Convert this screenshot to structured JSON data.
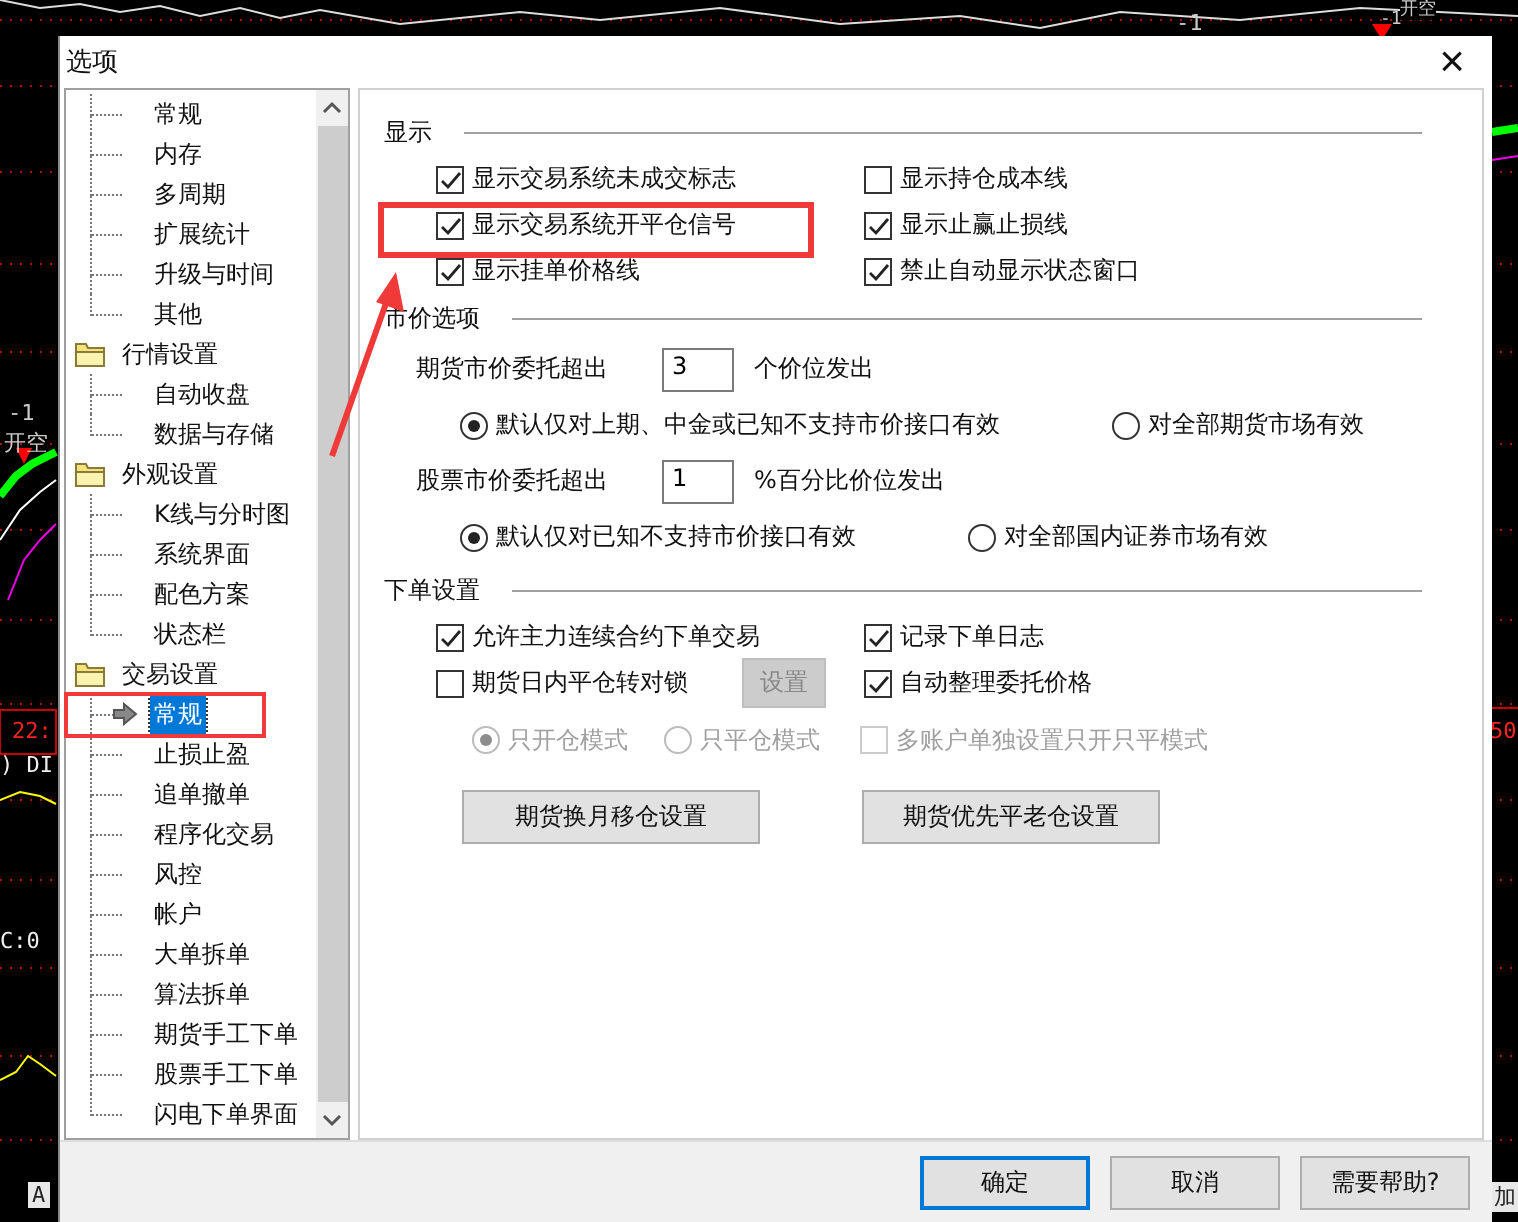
{
  "background": {
    "labels": [
      "-1",
      "开空",
      "-1",
      "-1",
      "开空",
      "22:",
      ") DI",
      "C:0",
      "A",
      "50",
      "加"
    ]
  },
  "window": {
    "title": "选项",
    "close": "×"
  },
  "tree": [
    {
      "children": [
        {
          "label": "常规",
          "selected": false
        },
        {
          "label": "内存",
          "selected": false
        },
        {
          "label": "多周期",
          "selected": false
        },
        {
          "label": "扩展统计",
          "selected": false
        },
        {
          "label": "升级与时间",
          "selected": false
        },
        {
          "label": "其他",
          "selected": false
        }
      ]
    },
    {
      "label": "行情设置",
      "children": [
        {
          "label": "自动收盘",
          "selected": false
        },
        {
          "label": "数据与存储",
          "selected": false
        }
      ]
    },
    {
      "label": "外观设置",
      "children": [
        {
          "label": "K线与分时图",
          "selected": false
        },
        {
          "label": "系统界面",
          "selected": false
        },
        {
          "label": "配色方案",
          "selected": false
        },
        {
          "label": "状态栏",
          "selected": false
        }
      ]
    },
    {
      "label": "交易设置",
      "children": [
        {
          "label": "常规",
          "selected": true
        },
        {
          "label": "止损止盈",
          "selected": false
        },
        {
          "label": "追单撤单",
          "selected": false
        },
        {
          "label": "程序化交易",
          "selected": false
        },
        {
          "label": "风控",
          "selected": false
        },
        {
          "label": "帐户",
          "selected": false
        },
        {
          "label": "大单拆单",
          "selected": false
        },
        {
          "label": "算法拆单",
          "selected": false
        },
        {
          "label": "期货手工下单",
          "selected": false
        },
        {
          "label": "股票手工下单",
          "selected": false
        },
        {
          "label": "闪电下单界面",
          "selected": false
        }
      ]
    }
  ],
  "sections": [
    {
      "title": "显示",
      "rows": [
        {
          "kind": "pair",
          "left": [
            {
              "kind": "checkbox",
              "label": "显示交易系统未成交标志",
              "checked": true,
              "disabled": false
            }
          ],
          "right": [
            {
              "kind": "checkbox",
              "label": "显示持仓成本线",
              "checked": false,
              "disabled": false
            }
          ]
        },
        {
          "kind": "pair",
          "left": [
            {
              "kind": "checkbox",
              "label": "显示交易系统开平仓信号",
              "checked": true,
              "disabled": false
            }
          ],
          "right": [
            {
              "kind": "checkbox",
              "label": "显示止赢止损线",
              "checked": true,
              "disabled": false
            }
          ]
        },
        {
          "kind": "pair",
          "left": [
            {
              "kind": "checkbox",
              "label": "显示挂单价格线",
              "checked": true,
              "disabled": false
            }
          ],
          "right": [
            {
              "kind": "checkbox",
              "label": "禁止自动显示状态窗口",
              "checked": true,
              "disabled": false
            }
          ]
        }
      ]
    },
    {
      "title": "市价选项",
      "rows": [
        {
          "kind": "spin",
          "label": "期货市价委托超出",
          "value": "3",
          "unit": "个价位发出"
        },
        {
          "kind": "radios",
          "items": [
            {
              "label": "默认仅对上期、中金或已知不支持市价接口有效",
              "selected": true,
              "disabled": false
            },
            {
              "label": "对全部期货市场有效",
              "selected": false,
              "disabled": false
            }
          ]
        },
        {
          "kind": "spin",
          "label": "股票市价委托超出",
          "value": "1",
          "unit": "%百分比价位发出"
        },
        {
          "kind": "radios",
          "items": [
            {
              "label": "默认仅对已知不支持市价接口有效",
              "selected": true,
              "disabled": false
            },
            {
              "label": "对全部国内证券市场有效",
              "selected": false,
              "disabled": false
            }
          ]
        }
      ]
    },
    {
      "title": "下单设置",
      "rows": [
        {
          "kind": "pair",
          "left": [
            {
              "kind": "checkbox",
              "label": "允许主力连续合约下单交易",
              "checked": true,
              "disabled": false
            }
          ],
          "right": [
            {
              "kind": "checkbox",
              "label": "记录下单日志",
              "checked": true,
              "disabled": false
            }
          ]
        },
        {
          "kind": "pair",
          "left": [
            {
              "kind": "checkbox",
              "label": "期货日内平仓转对锁",
              "checked": false,
              "disabled": false
            },
            {
              "kind": "button",
              "label": "设置",
              "disabled": true
            }
          ],
          "right": [
            {
              "kind": "checkbox",
              "label": "自动整理委托价格",
              "checked": true,
              "disabled": false
            }
          ]
        },
        {
          "kind": "options",
          "items": [
            {
              "kind": "radio",
              "label": "只开仓模式",
              "selected": true,
              "disabled": true
            },
            {
              "kind": "radio",
              "label": "只平仓模式",
              "selected": false,
              "disabled": true
            },
            {
              "kind": "checkbox",
              "label": "多账户单独设置只开只平模式",
              "checked": false,
              "disabled": true
            }
          ]
        },
        {
          "kind": "buttons",
          "items": [
            {
              "label": "期货换月移仓设置"
            },
            {
              "label": "期货优先平老仓设置"
            }
          ]
        }
      ]
    }
  ],
  "footer": [
    {
      "label": "确定",
      "default": true
    },
    {
      "label": "取消",
      "default": false
    },
    {
      "label": "需要帮助?",
      "default": false
    }
  ]
}
